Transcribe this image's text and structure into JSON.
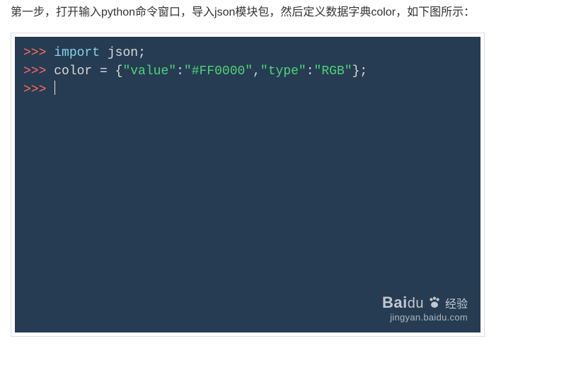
{
  "instruction": "第一步，打开输入python命令窗口，导入json模块包，然后定义数据字典color，如下图所示：",
  "code": {
    "line1": {
      "prompt": ">>> ",
      "kw": "import",
      "space": " ",
      "module": "json",
      "semi": ";"
    },
    "line2": {
      "prompt": ">>> ",
      "var": "color",
      "eq": " = ",
      "lbrace": "{",
      "k1": "\"value\"",
      "colon1": ":",
      "v1": "\"#FF0000\"",
      "comma": ",",
      "k2": "\"type\"",
      "colon2": ":",
      "v2": "\"RGB\"",
      "rbrace": "}",
      "semi": ";"
    },
    "line3": {
      "prompt": ">>> "
    }
  },
  "watermark": {
    "brand_bai": "Bai",
    "brand_du": "du",
    "experience": "经验",
    "url": "jingyan.baidu.com"
  }
}
